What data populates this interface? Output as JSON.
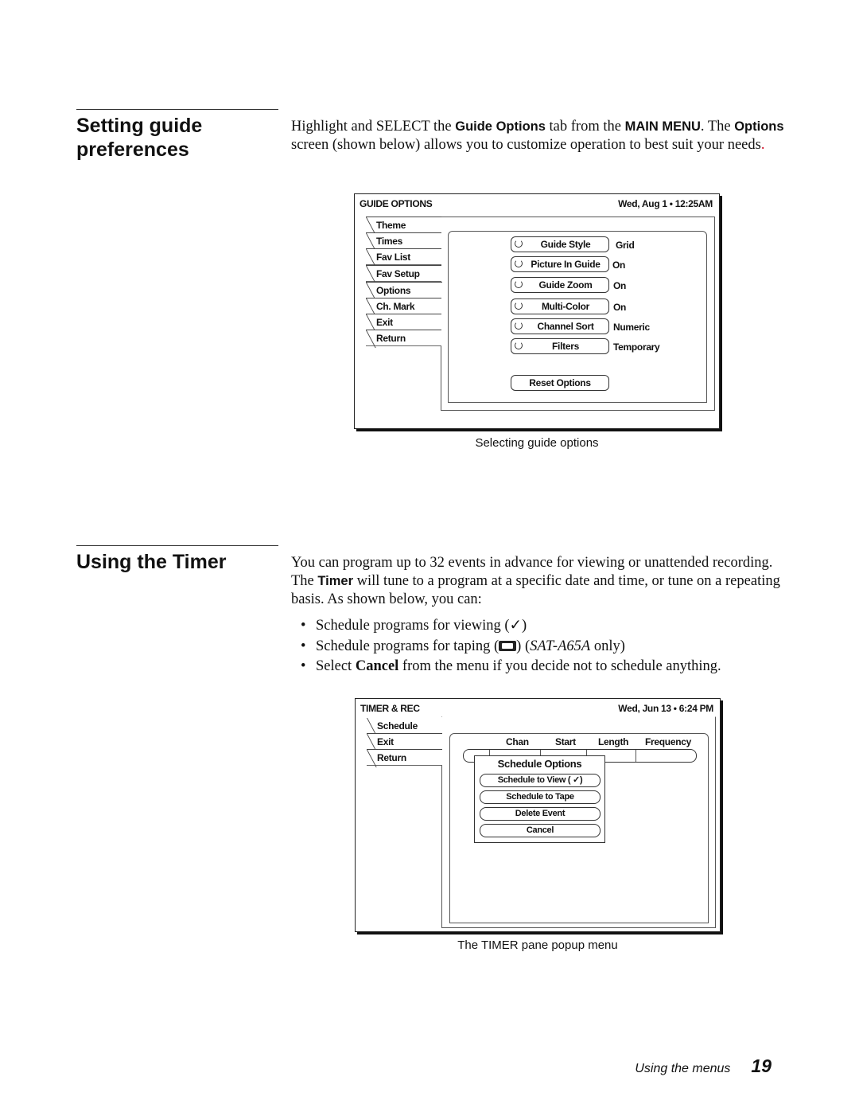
{
  "section1": {
    "heading": "Setting guide preferences",
    "heading_line1": "Setting guide",
    "heading_line2": "preferences",
    "para": {
      "t1": "Highlight and SELECT the ",
      "b1": "Guide Options",
      "t2": " tab from the ",
      "b2": "MAIN MENU",
      "t3": ". The ",
      "b3": "Options",
      "t4": " screen (shown below) allows you to customize operation to best suit your needs",
      "t5": "."
    },
    "screen": {
      "title": "GUIDE OPTIONS",
      "clock": "Wed, Aug 1 •  12:25AM",
      "tabs": [
        "Theme",
        "Times",
        "Fav List",
        "Fav Setup",
        "Options",
        "Ch. Mark",
        "Exit",
        "Return"
      ],
      "active_tab": "Options",
      "options": [
        {
          "label": "Guide Style",
          "value": "Grid"
        },
        {
          "label": "Picture In Guide",
          "value": "On"
        },
        {
          "label": "Guide Zoom",
          "value": "On"
        },
        {
          "label": "Multi-Color",
          "value": "On"
        },
        {
          "label": "Channel Sort",
          "value": "Numeric"
        },
        {
          "label": "Filters",
          "value": "Temporary"
        }
      ],
      "reset_label": "Reset Options"
    },
    "caption": "Selecting guide options"
  },
  "section2": {
    "heading": "Using the Timer",
    "para": {
      "t1": "You can program up to 32 events in advance for viewing or unattended recording. The ",
      "b1": "Timer",
      "t2": " will tune to a program at a specific date and time, or tune on a repeating basis. As shown below, you can:"
    },
    "bullets": [
      {
        "text": "Schedule programs for viewing (",
        "icon": "check-icon",
        "glyph": "✓",
        "after": ")"
      },
      {
        "text": "Schedule programs for taping (",
        "icon": "tape-icon",
        "after": ") ",
        "italic": "SAT-A65A",
        "tail": " only)"
      },
      {
        "pre": "Select ",
        "bold": "Cancel",
        "text": " from the menu if you decide not to schedule anything."
      }
    ],
    "screen": {
      "title": "TIMER & REC",
      "clock": "Wed, Jun 13  •  6:24 PM",
      "tabs": [
        "Schedule",
        "Exit",
        "Return"
      ],
      "columns": [
        "Chan",
        "Start",
        "Length",
        "Frequency"
      ],
      "popup": {
        "title": "Schedule Options",
        "items": [
          "Schedule to View ( ✓)",
          "Schedule to Tape",
          "Delete Event",
          "Cancel"
        ]
      }
    },
    "caption": "The TIMER pane popup menu"
  },
  "footer": {
    "section": "Using the menus",
    "page": "19"
  }
}
